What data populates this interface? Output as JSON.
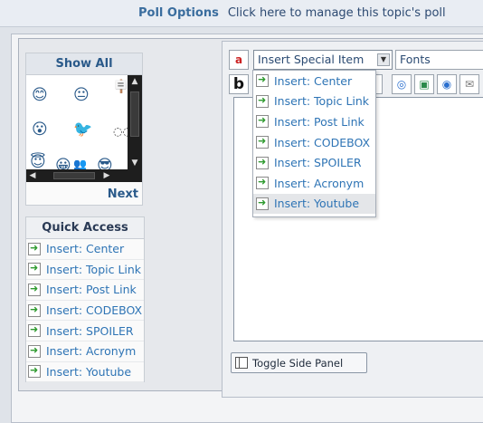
{
  "topbar": {
    "title": "Poll Options",
    "manage_text": "Click here to manage this topic's poll"
  },
  "emoticons": {
    "show_all": "Show All",
    "next": "Next",
    "items": [
      "smile",
      "wink",
      "sign-smiley",
      "grin",
      "bird",
      "tongue",
      "angel",
      "happy",
      "crowd",
      "cool"
    ]
  },
  "quick_access": {
    "title": "Quick Access",
    "items": [
      "Insert: Center",
      "Insert: Topic Link",
      "Insert: Post Link",
      "Insert: CODEBOX",
      "Insert: SPOILER",
      "Insert: Acronym",
      "Insert: Youtube"
    ]
  },
  "editor": {
    "special_select": "Insert Special Item",
    "fonts_select": "Fonts",
    "bold_label": "b",
    "toggle_label": "Toggle Side Panel"
  },
  "dropdown": {
    "items": [
      "Insert: Center",
      "Insert: Topic Link",
      "Insert: Post Link",
      "Insert: CODEBOX",
      "Insert: SPOILER",
      "Insert: Acronym",
      "Insert: Youtube"
    ],
    "highlighted_index": 6
  },
  "colors": {
    "link": "#2e74b5",
    "heading": "#2a5a8a",
    "arrow": "#2f9a2f"
  }
}
